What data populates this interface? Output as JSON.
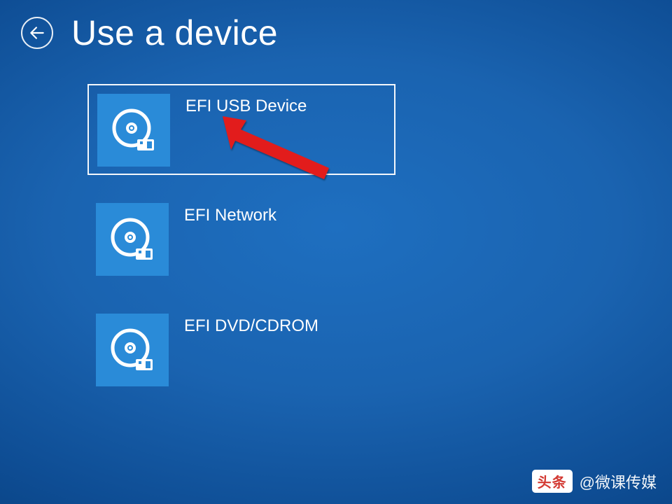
{
  "header": {
    "title": "Use a device"
  },
  "options": [
    {
      "label": "EFI USB Device",
      "selected": true
    },
    {
      "label": "EFI Network",
      "selected": false
    },
    {
      "label": "EFI DVD/CDROM",
      "selected": false
    }
  ],
  "watermark": {
    "badge": "头条",
    "text": "@微课传媒"
  }
}
